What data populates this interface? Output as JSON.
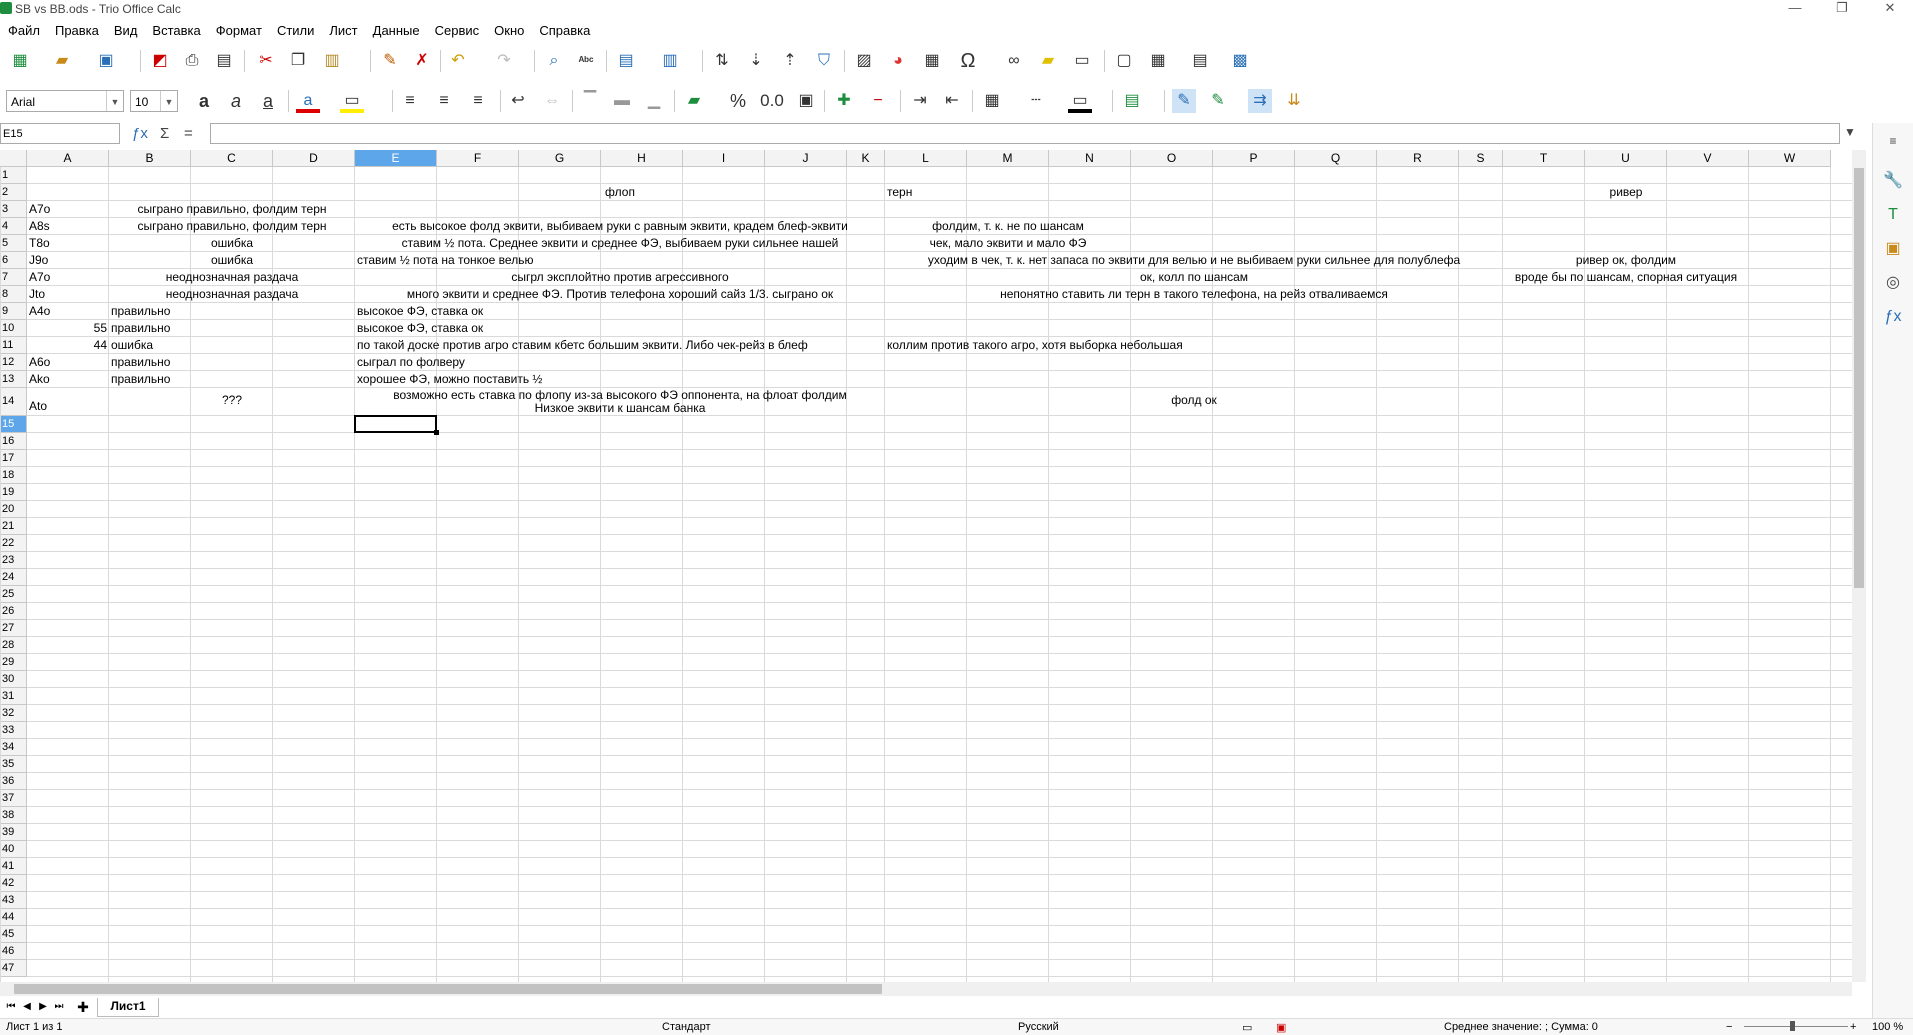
{
  "window": {
    "title": "SB vs BB.ods - Trio Office Calc",
    "min": "—",
    "max": "❐",
    "close": "✕"
  },
  "menu": [
    "Файл",
    "Правка",
    "Вид",
    "Вставка",
    "Формат",
    "Стили",
    "Лист",
    "Данные",
    "Сервис",
    "Окно",
    "Справка"
  ],
  "toolbar2": {
    "font": "Arial",
    "size": "10"
  },
  "formula": {
    "cell_ref": "E15",
    "content": ""
  },
  "columns": [
    "A",
    "B",
    "C",
    "D",
    "E",
    "F",
    "G",
    "H",
    "I",
    "J",
    "K",
    "L",
    "M",
    "N",
    "O",
    "P",
    "Q",
    "R",
    "S",
    "T",
    "U",
    "V",
    "W"
  ],
  "rows": [
    "1",
    "2",
    "3",
    "4",
    "5",
    "6",
    "7",
    "8",
    "9",
    "10",
    "11",
    "12",
    "13",
    "14",
    "15",
    "16",
    "17",
    "18",
    "19",
    "20",
    "21",
    "22",
    "23",
    "24",
    "25",
    "26",
    "27",
    "28",
    "29",
    "30",
    "31",
    "32",
    "33",
    "34",
    "35",
    "36",
    "37",
    "38",
    "39",
    "40",
    "41",
    "42",
    "43",
    "44",
    "45",
    "46",
    "47"
  ],
  "cells": {
    "r2_flop": "флоп",
    "r2_turn": "терн",
    "r2_river": "ривер",
    "r3_a": "A7o",
    "r3_bc": "сыграно правильно, фолдим терн",
    "r4_a": "A8s",
    "r4_bc": "сыграно правильно, фолдим терн",
    "r4_flop": "есть высокое фолд эквити, выбиваем руки с равным эквити, крадем блеф-эквити",
    "r4_turn": "фолдим, т. к. не по шансам",
    "r5_a": "T8o",
    "r5_bc": "ошибка",
    "r5_flop": "ставим ½ пота. Среднее эквити и среднее ФЭ, выбиваем руки сильнее нашей",
    "r5_turn": "чек, мало эквити и мало ФЭ",
    "r6_a": "J9o",
    "r6_bc": "ошибка",
    "r6_flop": "ставим ½ пота на тонкое велью",
    "r6_turn": "уходим в чек, т. к. нет запаса по эквити для велью и не выбиваем руки сильнее для полублефа",
    "r6_river": "ривер ок, фолдим",
    "r7_a": "A7o",
    "r7_bc": "неоднозначная раздача",
    "r7_flop": "сыгрл эксплойтно против агрессивного",
    "r7_turn": "ок, колл по шансам",
    "r7_river": "вроде бы по шансам, спорная ситуация",
    "r8_a": "Jto",
    "r8_bc": "неоднозначная раздача",
    "r8_flop": "много эквити и среднее ФЭ. Против телефона хороший сайз 1/3. сыграно ок",
    "r8_turn": "непонятно ставить ли терн в такого телефона, на рейз отваливаемся",
    "r9_a": "A4o",
    "r9_b": "правильно",
    "r9_e": "высокое ФЭ, ставка ок",
    "r10_a": "55",
    "r10_b": "правильно",
    "r10_e": "высокое ФЭ, ставка ок",
    "r11_a": "44",
    "r11_b": "ошибка",
    "r11_e": "по такой доске против агро ставим кбетс большим эквити. Либо чек-рейз в блеф",
    "r11_l": "коллим против такого агро, хотя выборка небольшая",
    "r12_a": "A6o",
    "r12_b": "правильно",
    "r12_e": "сыграл по фолверу",
    "r13_a": "Ako",
    "r13_b": "правильно",
    "r13_e": "хорошее ФЭ, можно поставить ½",
    "r14_a": "Ato",
    "r14_bc": "???",
    "r14_flop1": "возможно есть ставка по флопу из-за высокого ФЭ оппонента, на флоат фолдим",
    "r14_flop2": "Низкое эквити к шансам банка",
    "r14_turn": "фолд ок"
  },
  "sheet_tab": "Лист1",
  "status": {
    "sheet": "Лист 1 из 1",
    "style": "Стандарт",
    "lang": "Русский",
    "summary": "Среднее значение: ; Сумма: 0",
    "zoom": "100 %"
  }
}
